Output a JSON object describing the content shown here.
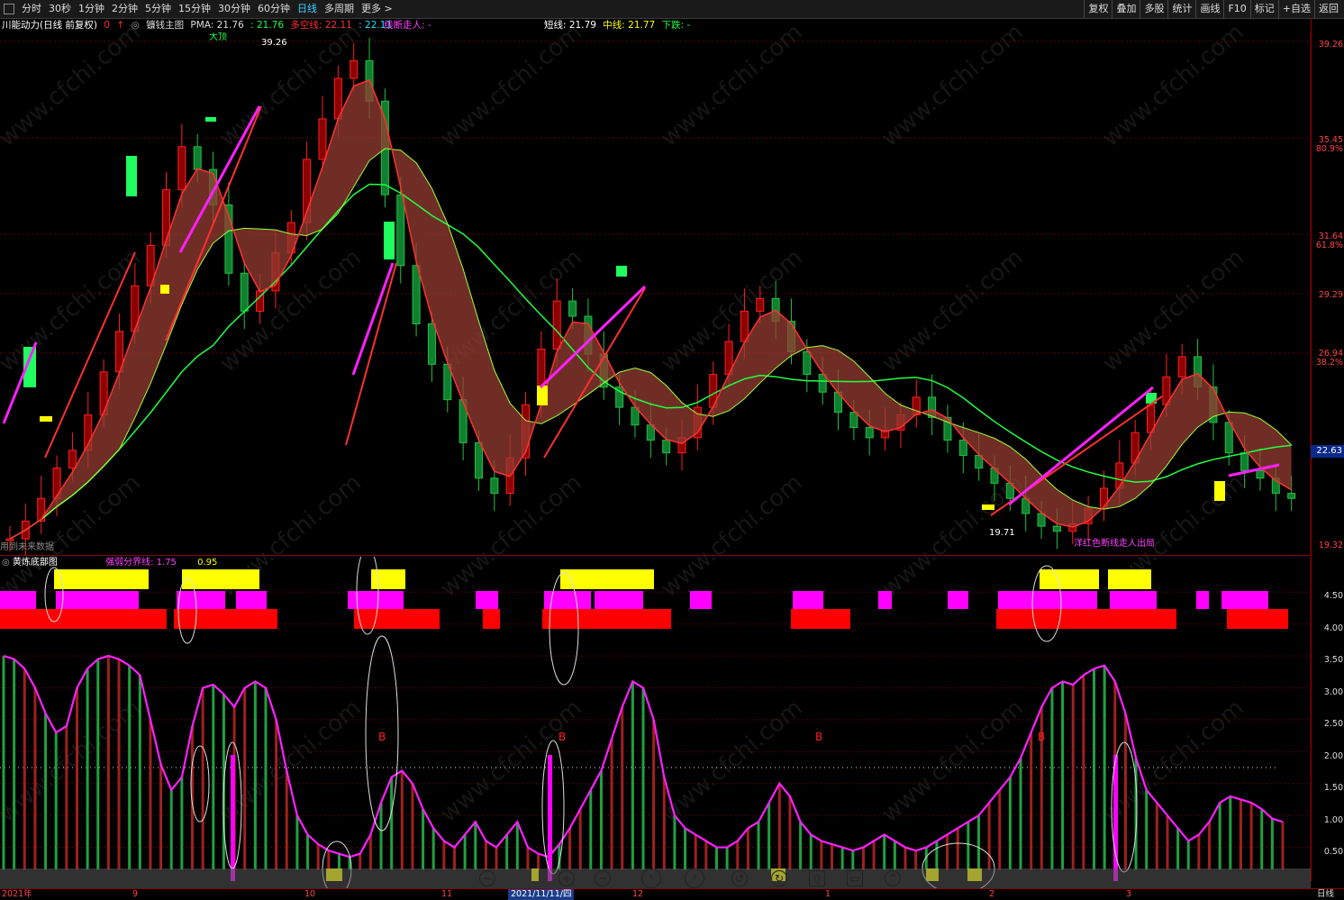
{
  "toolbar": {
    "left_items": [
      "分时",
      "30秒",
      "1分钟",
      "2分钟",
      "5分钟",
      "15分钟",
      "30分钟",
      "60分钟",
      "日线",
      "多周期",
      "更多 >"
    ],
    "active": "日线",
    "right_items": [
      "复权",
      "叠加",
      "多股",
      "统计",
      "画线",
      "F10",
      "标记",
      "+自选",
      "返回"
    ]
  },
  "header": {
    "stock": "川能动力(日线 前复权)",
    "indicator": "镰钱主图",
    "pma_label": "PMA: 21.76",
    "v1": ": 21.76",
    "duokong": "多空线: 22.11",
    "v2": ": 22.11",
    "xuduan": "线断走人: -",
    "short": "短线: 21.79",
    "mid": "中线: 21.77",
    "down": "下跌: -"
  },
  "price_axis": {
    "labels": [
      "39.26",
      "35.45",
      "80.9%",
      "31.64",
      "61.8%",
      "29.29",
      "26.94",
      "38.2%",
      "19.32",
      "22.63"
    ],
    "current": "22.63"
  },
  "annotations": {
    "high": "39.26",
    "dading": "大顶",
    "low_mark": "19.71",
    "footnote": "用到未来数据",
    "bottom_msg": "洋红色断线走人出局"
  },
  "indicator": {
    "title": "黄炼底部图",
    "strength": "强弱分界线: 1.75",
    "val": "0.95",
    "axis": [
      "4.50",
      "4.00",
      "3.50",
      "3.00",
      "2.50",
      "2.00",
      "1.50",
      "1.00",
      "0.50"
    ],
    "marks": {
      "die": "跌",
      "cai": "财",
      "zhang": "涨"
    }
  },
  "dates": {
    "labels": [
      "2021年",
      "9",
      "10",
      "11",
      "12",
      "1",
      "2",
      "3"
    ],
    "cursor": "2021/11/11/四",
    "period": "日线"
  },
  "watermark": "www.cfchi.com",
  "colors": {
    "up": "#ff2020",
    "down": "#20e0ff",
    "magenta": "#ff00ff",
    "green": "#20ff40",
    "yellow": "#ffff00",
    "red": "#ff0000"
  },
  "chart_data": {
    "type": "candlestick",
    "ylim": [
      19.32,
      39.26
    ],
    "closes": [
      19.6,
      20.3,
      21.2,
      22.4,
      23.1,
      24.5,
      26.2,
      27.8,
      29.6,
      31.2,
      33.4,
      35.1,
      34.2,
      32.8,
      30.1,
      28.6,
      29.4,
      30.9,
      32.1,
      34.6,
      36.2,
      37.8,
      38.5,
      36.9,
      33.2,
      30.4,
      28.1,
      26.5,
      25.1,
      23.4,
      22.0,
      21.4,
      22.8,
      24.9,
      27.1,
      29.0,
      28.4,
      26.9,
      25.6,
      24.8,
      24.1,
      23.5,
      23.0,
      23.6,
      24.8,
      26.1,
      27.4,
      28.6,
      29.1,
      28.2,
      27.0,
      26.1,
      25.4,
      24.6,
      24.0,
      23.6,
      23.9,
      24.5,
      25.2,
      24.4,
      23.5,
      22.9,
      22.4,
      21.8,
      21.2,
      20.6,
      20.1,
      19.9,
      20.2,
      20.8,
      21.6,
      22.6,
      23.8,
      24.9,
      26.0,
      26.8,
      25.6,
      24.2,
      23.0,
      22.3,
      22.0,
      21.4,
      21.2
    ]
  }
}
